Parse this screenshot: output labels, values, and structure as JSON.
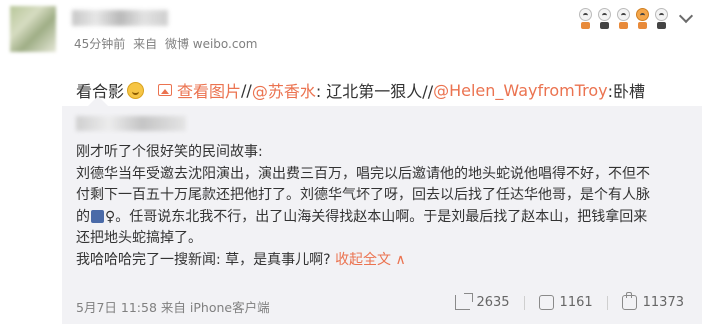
{
  "post": {
    "time": "45分钟前",
    "from_label": "来自",
    "source": "微博 weibo.com",
    "text_prefix": "看合影",
    "view_image_label": "查看图片",
    "sep1": " //",
    "mention1": "@苏香水",
    "text_mid": ": 辽北第一狠人//",
    "mention2": "@Helen_WayfromTroy",
    "text_end": ":卧槽"
  },
  "repost": {
    "line1": "刚才听了个很好笑的民间故事:",
    "line2": "刘德华当年受邀去沈阳演出，演出费三百万，唱完以后邀请他的地头蛇说他唱得不好，不但不",
    "line3": "付剩下一百五十万尾款还把他打了。刘德华气坏了呀，回去以后找了任达华他哥，是个有人脉",
    "line4a": "的",
    "line4b": "♀。任哥说东北我不行，出了山海关得找赵本山啊。于是刘最后找了赵本山，把钱拿回来",
    "line5": "还把地头蛇搞掉了。",
    "line6": "我哈哈哈完了一搜新闻: 草，是真事儿啊?",
    "collapse_label": "收起全文 ∧",
    "time": "5月7日 11:58",
    "from_label": "来自",
    "source": "iPhone客户端",
    "repost_count": "2635",
    "comment_count": "1161",
    "like_count": "11373"
  },
  "colors": {
    "link": "#eb7350",
    "muted": "#808080",
    "repost_bg": "#f2f2f5"
  },
  "icons": [
    "emoji-stickers",
    "chevron-down-icon",
    "smile-emoji-icon",
    "picture-icon",
    "police-emoji-icon",
    "female-sign-icon",
    "repost-icon",
    "comment-icon",
    "like-icon"
  ]
}
